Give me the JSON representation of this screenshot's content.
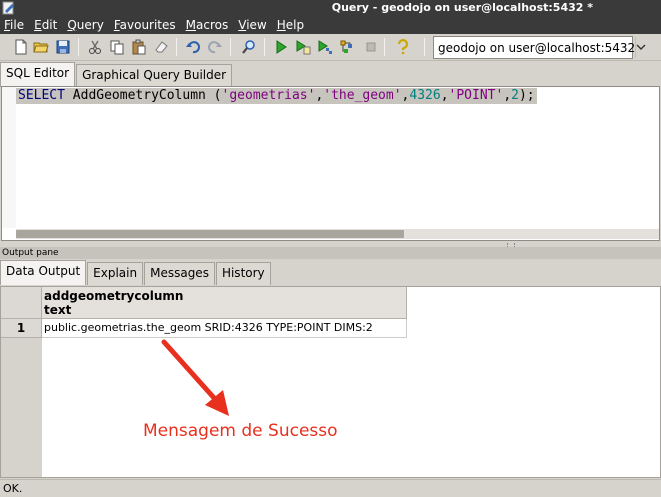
{
  "window": {
    "title": "Query - geodojo on user@localhost:5432 *"
  },
  "menu": [
    {
      "label_u": "F",
      "label_rest": "ile"
    },
    {
      "label_u": "E",
      "label_rest": "dit"
    },
    {
      "label_u": "Q",
      "label_rest": "uery"
    },
    {
      "label_u": "F",
      "label_rest": "avourites"
    },
    {
      "label_u": "M",
      "label_rest": "acros"
    },
    {
      "label_u": "V",
      "label_rest": "iew"
    },
    {
      "label_u": "H",
      "label_rest": "elp"
    }
  ],
  "toolbar": {
    "connection_value": "geodojo on user@localhost:5432"
  },
  "editor_tabs": [
    "SQL Editor",
    "Graphical Query Builder"
  ],
  "editor": {
    "sql": {
      "keyword": "SELECT",
      "func": "AddGeometryColumn (",
      "s1": "'geometrias'",
      "c1": ",",
      "s2": "'the_geom'",
      "c2": ",",
      "n1": "4326",
      "c3": ",",
      "s3": "'POINT'",
      "c4": ",",
      "n2": "2",
      "end": ");"
    }
  },
  "output": {
    "pane_label": "Output pane",
    "tabs": [
      "Data Output",
      "Explain",
      "Messages",
      "History"
    ],
    "grid": {
      "column_name": "addgeometrycolumn",
      "column_type": "text",
      "row_number": "1",
      "cell_value": "public.geometrias.the_geom SRID:4326 TYPE:POINT DIMS:2"
    }
  },
  "annotation": {
    "text": "Mensagem de Sucesso",
    "color": "#e8301e"
  },
  "status": {
    "text": "OK."
  }
}
